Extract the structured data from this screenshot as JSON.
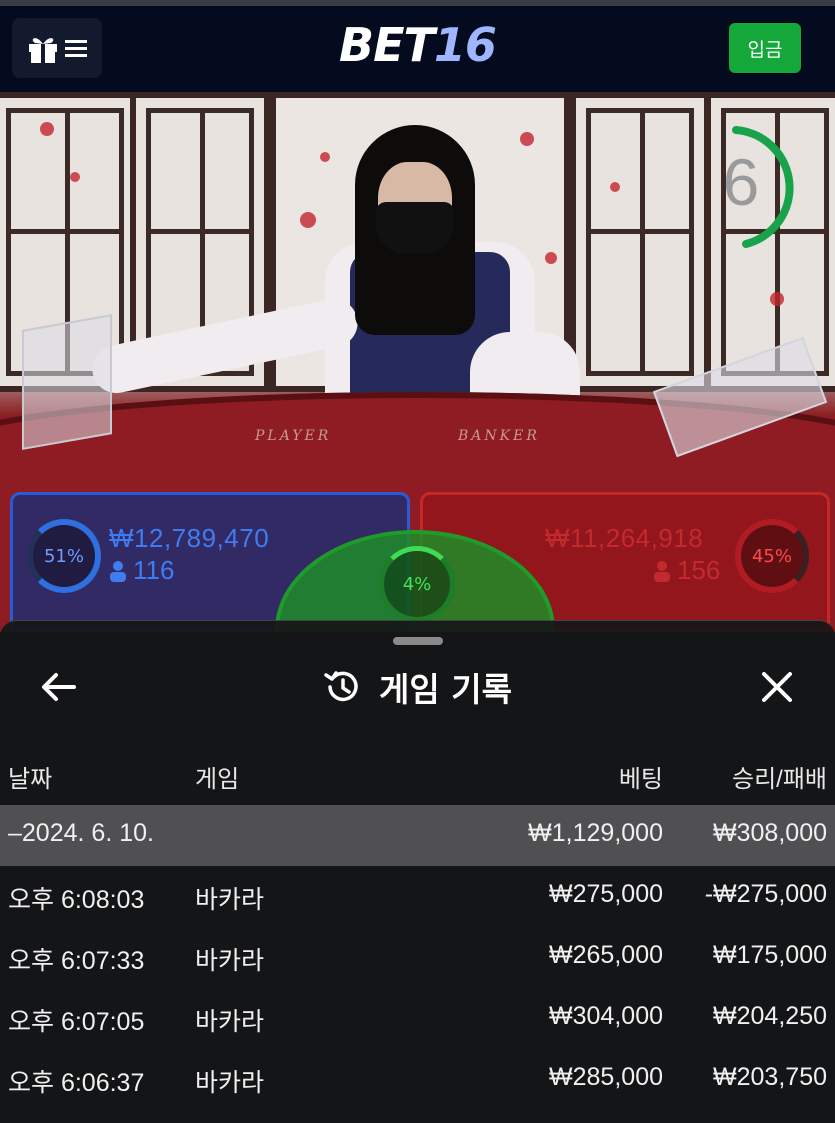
{
  "header": {
    "logo_part1": "BET",
    "logo_part2": "16",
    "deposit_label": "입금"
  },
  "stream": {
    "timer": "6",
    "felt_player": "PLAYER",
    "felt_banker": "BANKER"
  },
  "bets": {
    "player": {
      "percent": "51%",
      "amount": "₩12,789,470",
      "count": "116"
    },
    "tie": {
      "percent": "4%"
    },
    "banker": {
      "percent": "45%",
      "amount": "₩11,264,918",
      "count": "156"
    }
  },
  "sheet": {
    "title": "게임 기록",
    "columns": {
      "date": "날짜",
      "game": "게임",
      "bet": "베팅",
      "winloss": "승리/패배"
    },
    "group": {
      "date": "–2024. 6. 10.",
      "bet": "₩1,129,000",
      "winloss": "₩308,000"
    },
    "rows": [
      {
        "time": "오후 6:08:03",
        "game": "바카라",
        "bet": "₩275,000",
        "winloss": "-₩275,000"
      },
      {
        "time": "오후 6:07:33",
        "game": "바카라",
        "bet": "₩265,000",
        "winloss": "₩175,000"
      },
      {
        "time": "오후 6:07:05",
        "game": "바카라",
        "bet": "₩304,000",
        "winloss": "₩204,250"
      },
      {
        "time": "오후 6:06:37",
        "game": "바카라",
        "bet": "₩285,000",
        "winloss": "₩203,750"
      }
    ]
  },
  "colors": {
    "header_bg": "#050b1f",
    "deposit_green": "#14a83a",
    "player_blue": "#2f6fe0",
    "banker_red": "#c62828",
    "tie_green": "#1e9b2b"
  }
}
